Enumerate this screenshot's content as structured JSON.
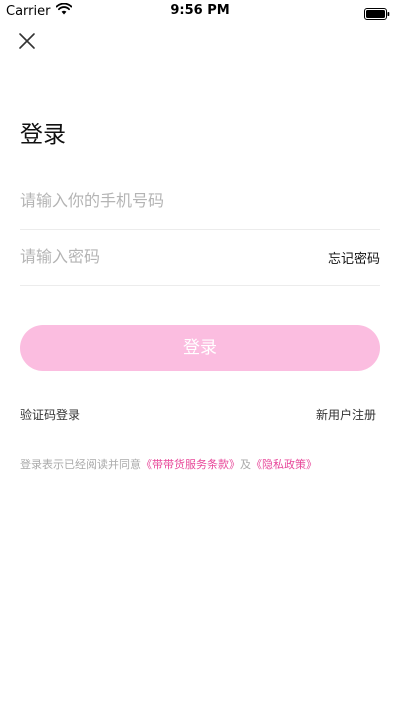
{
  "status_bar": {
    "carrier": "Carrier",
    "time": "9:56 PM"
  },
  "icons": {
    "close": "close-icon",
    "wifi": "wifi-icon",
    "battery": "battery-icon"
  },
  "title": "登录",
  "phone_field": {
    "value": "",
    "placeholder": "请输入你的手机号码"
  },
  "password_field": {
    "value": "",
    "placeholder": "请输入密码"
  },
  "forgot_password": "忘记密码",
  "login_button": "登录",
  "sms_login": "验证码登录",
  "register": "新用户注册",
  "agreement": {
    "prefix": "登录表示已经阅读并同意",
    "terms": "《带带货服务条款》",
    "and": "及",
    "privacy": "《隐私政策》"
  },
  "colors": {
    "accent": "#fbbde0",
    "link": "#e8489a",
    "placeholder": "#b4b4b4"
  }
}
